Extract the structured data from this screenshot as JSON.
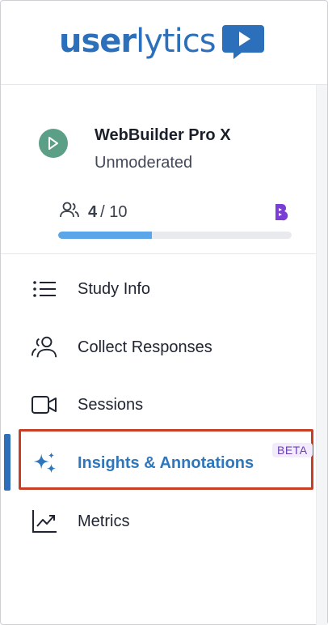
{
  "brand": {
    "logo_bold": "user",
    "logo_light": "lytics",
    "logo_color": "#2c6fba"
  },
  "study": {
    "title": "WebBuilder Pro X",
    "type": "Unmoderated",
    "participants_done": "4",
    "participants_total": "/ 10",
    "progress_fraction": 0.4,
    "badge_color": "#5b9f86"
  },
  "nav": {
    "items": [
      {
        "label": "Study Info",
        "icon": "list-icon"
      },
      {
        "label": "Collect Responses",
        "icon": "users-icon"
      },
      {
        "label": "Sessions",
        "icon": "video-camera-icon"
      },
      {
        "label": "Insights & Annotations",
        "icon": "sparkles-icon",
        "active": true,
        "badge": "BETA"
      },
      {
        "label": "Metrics",
        "icon": "chart-trend-icon"
      }
    ],
    "active_color": "#2f77bd",
    "highlight_color": "#c63f26"
  }
}
